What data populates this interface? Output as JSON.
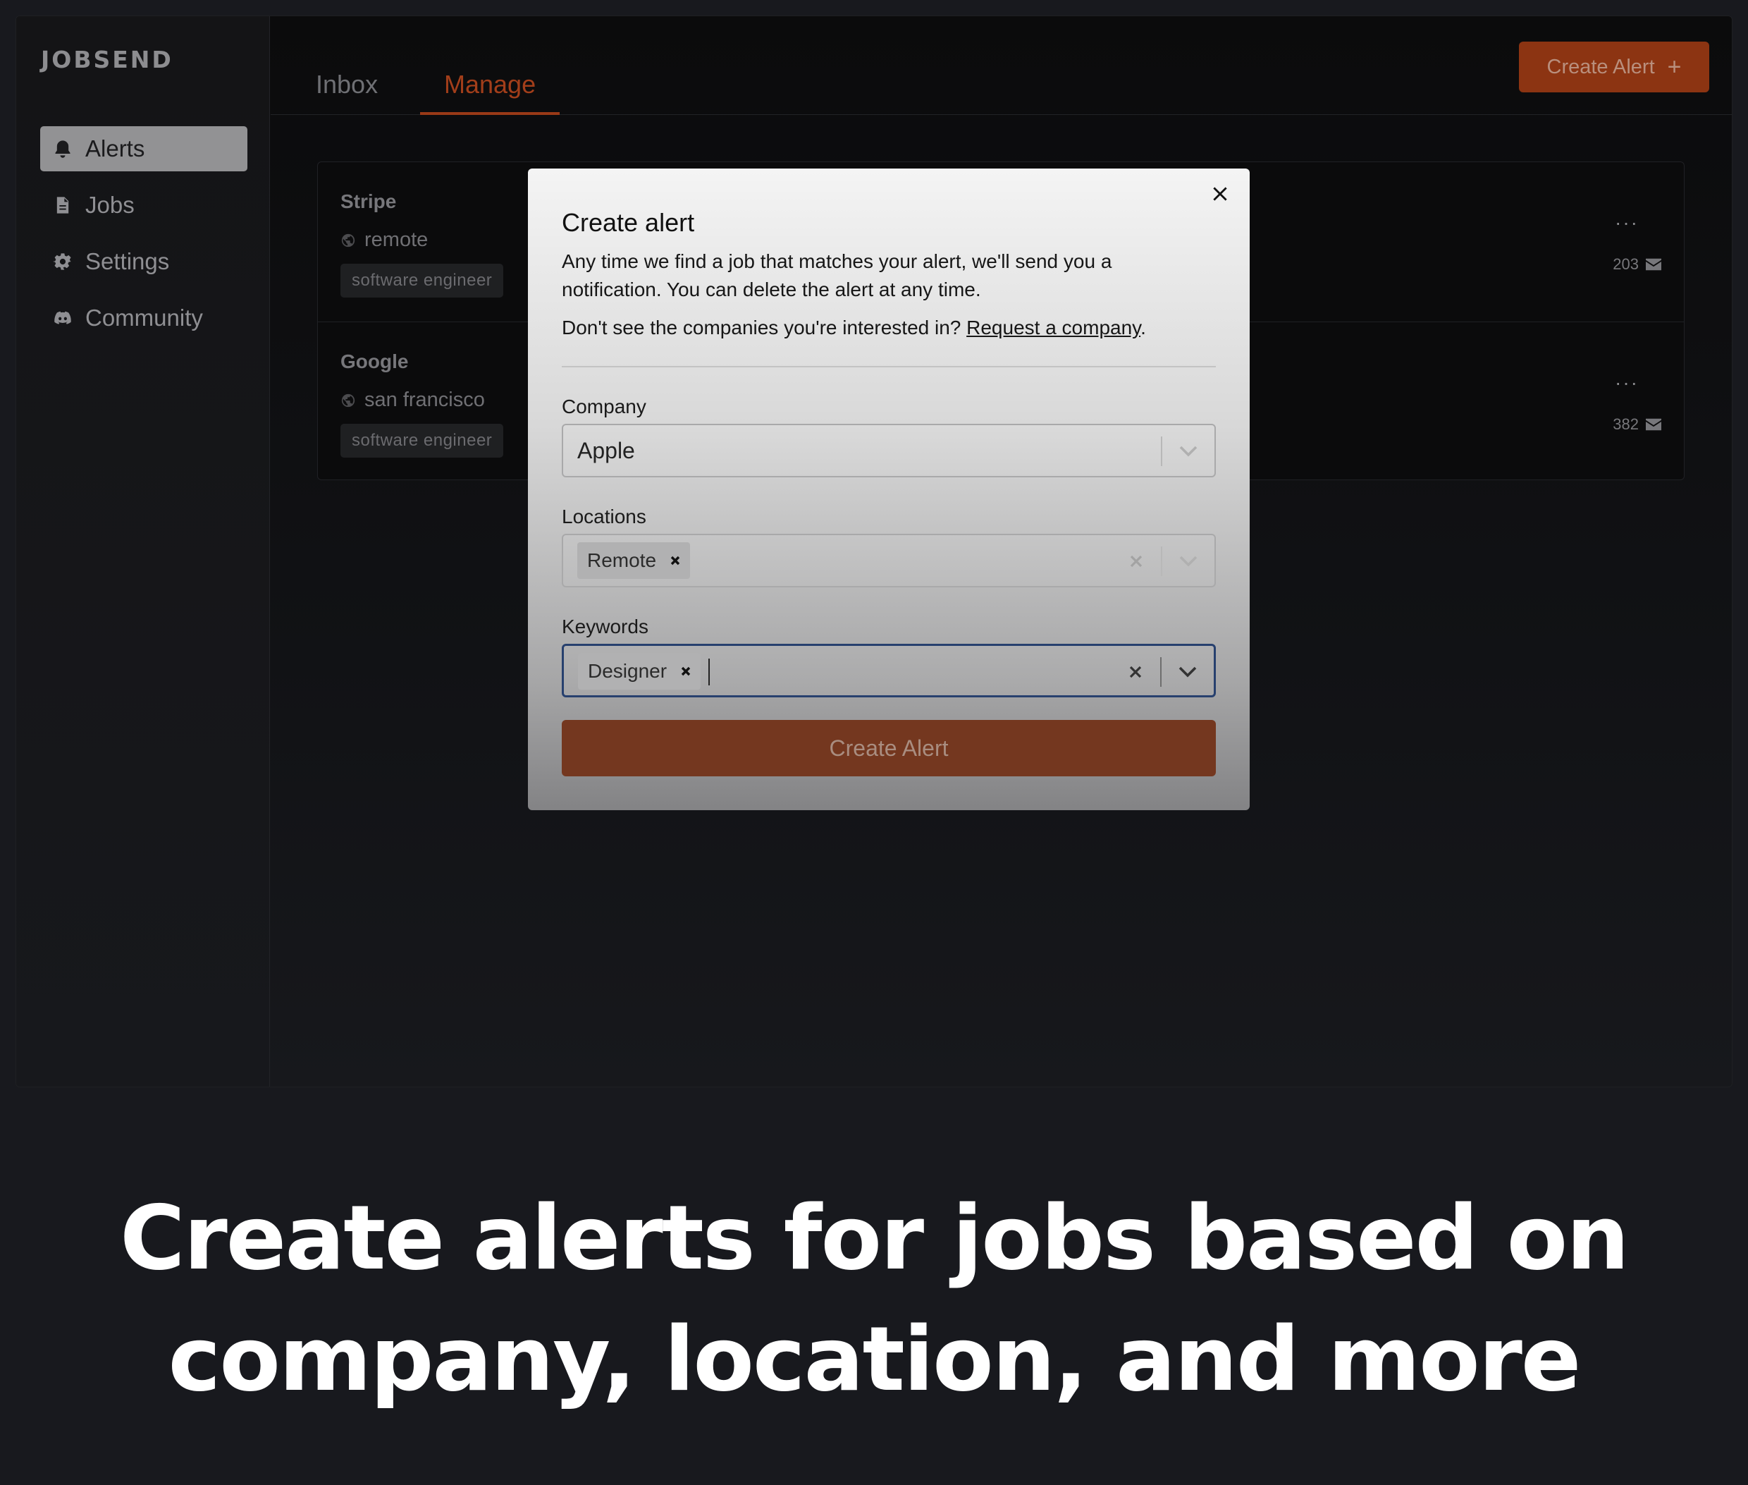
{
  "app": {
    "brand": "JOBSEND"
  },
  "sidebar": {
    "items": [
      {
        "label": "Alerts",
        "icon": "bell-icon",
        "active": true
      },
      {
        "label": "Jobs",
        "icon": "document-icon",
        "active": false
      },
      {
        "label": "Settings",
        "icon": "gear-icon",
        "active": false
      },
      {
        "label": "Community",
        "icon": "discord-icon",
        "active": false
      }
    ]
  },
  "tabs": [
    {
      "label": "Inbox",
      "active": false
    },
    {
      "label": "Manage",
      "active": true
    }
  ],
  "header": {
    "create_label": "Create Alert",
    "create_icon": "plus-icon"
  },
  "alerts": [
    {
      "company": "Stripe",
      "location": "remote",
      "keyword": "software engineer",
      "count": "203"
    },
    {
      "company": "Google",
      "location": "san francisco",
      "keyword": "software engineer",
      "count": "382"
    }
  ],
  "modal": {
    "title": "Create alert",
    "description": "Any time we find a job that matches your alert, we'll send you a notification. You can delete the alert at any time.",
    "request_prefix": "Don't see the companies you're interested in? ",
    "request_link": "Request a company",
    "request_suffix": ".",
    "company": {
      "label": "Company",
      "value": "Apple"
    },
    "locations": {
      "label": "Locations",
      "chips": [
        "Remote"
      ]
    },
    "keywords": {
      "label": "Keywords",
      "chips": [
        "Designer"
      ]
    },
    "submit_label": "Create Alert"
  },
  "caption": {
    "line1": "Create alerts for jobs based on",
    "line2": "company, location, and more"
  },
  "colors": {
    "accent": "#8c3412",
    "active_tab": "#a23e1a",
    "background": "#18191e"
  }
}
